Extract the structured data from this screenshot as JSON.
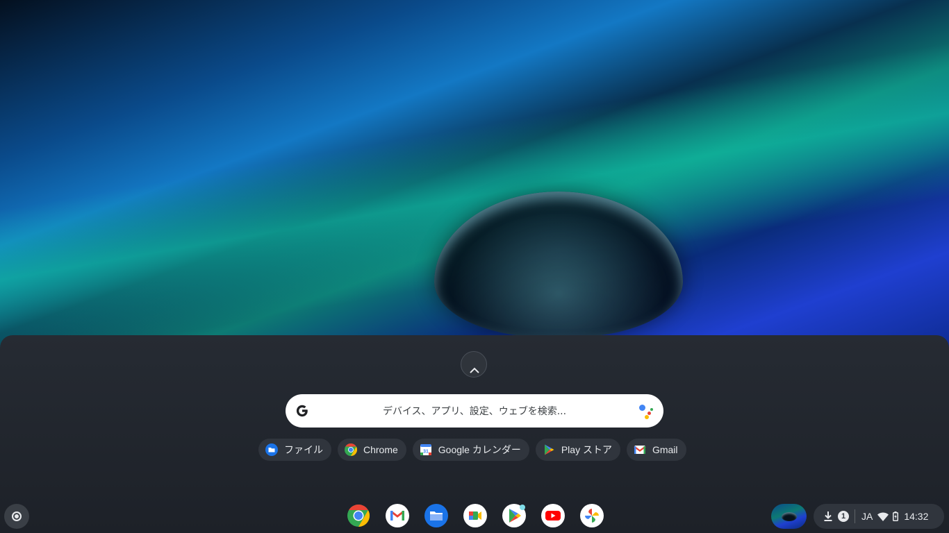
{
  "launcher": {
    "search": {
      "placeholder": "デバイス、アプリ、設定、ウェブを検索..."
    },
    "suggestions": [
      {
        "label": "ファイル",
        "icon": "files-icon"
      },
      {
        "label": "Chrome",
        "icon": "chrome-icon"
      },
      {
        "label": "Google カレンダー",
        "icon": "google-calendar-icon"
      },
      {
        "label": "Play ストア",
        "icon": "play-store-icon"
      },
      {
        "label": "Gmail",
        "icon": "gmail-icon"
      }
    ]
  },
  "shelf": {
    "apps": [
      {
        "name": "chrome",
        "icon": "chrome-icon"
      },
      {
        "name": "gmail",
        "icon": "gmail-icon"
      },
      {
        "name": "files",
        "icon": "files-icon"
      },
      {
        "name": "google-meet",
        "icon": "google-meet-icon"
      },
      {
        "name": "play-store",
        "icon": "play-store-icon"
      },
      {
        "name": "youtube",
        "icon": "youtube-icon"
      },
      {
        "name": "google-photos",
        "icon": "google-photos-icon"
      }
    ]
  },
  "status_area": {
    "notification_count": "1",
    "ime": "JA",
    "time": "14:32"
  },
  "colors": {
    "launcher_bg": "#262b33",
    "chip_bg": "#30353d",
    "text": "#e8eaed",
    "google_blue": "#4285f4",
    "google_red": "#ea4335",
    "google_yellow": "#fbbc04",
    "google_green": "#34a853"
  }
}
